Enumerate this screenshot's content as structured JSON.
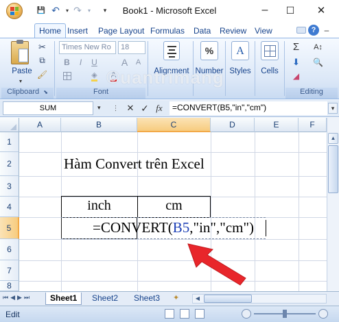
{
  "window": {
    "title": "Book1 - Microsoft Excel",
    "minimize_glyph": "–",
    "maximize_glyph": "☐",
    "close_glyph": "✕"
  },
  "qat": {
    "save": "💾",
    "undo": "↶",
    "redo": "↷",
    "more": "▾"
  },
  "ribbon_tabs": [
    "Home",
    "Insert",
    "Page Layout",
    "Formulas",
    "Data",
    "Review",
    "View"
  ],
  "ribbon_help_glyph": "?",
  "ribbon": {
    "clipboard": {
      "paste_label": "Paste",
      "group_label": "Clipboard"
    },
    "font": {
      "font_name": "Times New Ro",
      "font_size": "18",
      "bold": "B",
      "italic": "I",
      "underline": "U",
      "grow": "A",
      "shrink": "A",
      "group_label": "Font"
    },
    "alignment_label": "Alignment",
    "number_label": "Number",
    "number_glyph": "%",
    "styles_label": "Styles",
    "cells_label": "Cells",
    "editing": {
      "sum_glyph": "Σ",
      "group_label": "Editing"
    }
  },
  "formula_bar": {
    "name_box": "SUM",
    "cancel_glyph": "✕",
    "enter_glyph": "✓",
    "fx": "fx",
    "formula": "=CONVERT(B5,\"in\",\"cm\")"
  },
  "columns": [
    "A",
    "B",
    "C",
    "D",
    "E",
    "F"
  ],
  "rows": [
    "1",
    "2",
    "3",
    "4",
    "5",
    "6",
    "7",
    "8"
  ],
  "cells": {
    "B2": "Hàm Convert trên Excel",
    "B4": "inch",
    "C4": "cm",
    "B5_prefix": "=CONVERT(",
    "B5_ref": "B5",
    "B5_suffix": ",\"in\",\"cm\")"
  },
  "sheets": [
    "Sheet1",
    "Sheet2",
    "Sheet3"
  ],
  "active_sheet": "Sheet1",
  "status": {
    "mode": "Edit"
  },
  "colors": {
    "ribbon_text": "#15428b",
    "selected_column": "#f9d99f",
    "arrow": "#e8262b",
    "cell_ref": "#1c3fb5"
  }
}
